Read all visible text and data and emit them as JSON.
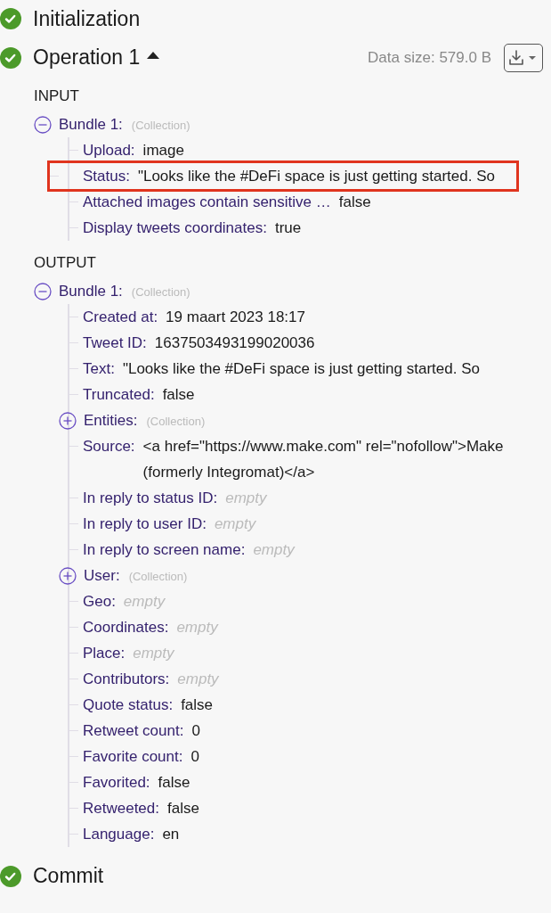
{
  "stages": [
    {
      "name": "Initialization",
      "done": true
    },
    {
      "name": "Operation 1",
      "done": true,
      "expanded": true,
      "data_size": "Data size: 579.0 B",
      "sections": [
        {
          "title": "INPUT",
          "bundles": [
            {
              "label": "Bundle 1:",
              "type": "(Collection)",
              "expanded": true,
              "items": [
                {
                  "kind": "field",
                  "label": "Upload:",
                  "value": "image",
                  "highlighted": false
                },
                {
                  "kind": "field",
                  "label": "Status:",
                  "value": "\"Looks like the #DeFi space is just getting started. So",
                  "highlighted": true
                },
                {
                  "kind": "field",
                  "label": "Attached images contain sensitive …",
                  "value": "false",
                  "highlighted": false
                },
                {
                  "kind": "field",
                  "label": "Display tweets coordinates:",
                  "value": "true",
                  "highlighted": false
                }
              ]
            }
          ]
        },
        {
          "title": "OUTPUT",
          "bundles": [
            {
              "label": "Bundle 1:",
              "type": "(Collection)",
              "expanded": true,
              "items": [
                {
                  "kind": "field",
                  "label": "Created at:",
                  "value": "19 maart 2023 18:17",
                  "highlighted": false
                },
                {
                  "kind": "field",
                  "label": "Tweet ID:",
                  "value": "1637503493199020036",
                  "highlighted": false
                },
                {
                  "kind": "field",
                  "label": "Text:",
                  "value": "\"Looks like the #DeFi space is just getting started. So",
                  "highlighted": false
                },
                {
                  "kind": "field",
                  "label": "Truncated:",
                  "value": "false",
                  "highlighted": false
                },
                {
                  "kind": "collection",
                  "label": "Entities:",
                  "value": "(Collection)",
                  "expanded": false
                },
                {
                  "kind": "field",
                  "label": "Source:",
                  "value": "<a href=\"https://www.make.com\" rel=\"nofollow\">Make (formerly Integromat)</a>",
                  "highlighted": false
                },
                {
                  "kind": "empty",
                  "label": "In reply to status ID:",
                  "value": "empty"
                },
                {
                  "kind": "empty",
                  "label": "In reply to user ID:",
                  "value": "empty"
                },
                {
                  "kind": "empty",
                  "label": "In reply to screen name:",
                  "value": "empty"
                },
                {
                  "kind": "collection",
                  "label": "User:",
                  "value": "(Collection)",
                  "expanded": false
                },
                {
                  "kind": "empty",
                  "label": "Geo:",
                  "value": "empty"
                },
                {
                  "kind": "empty",
                  "label": "Coordinates:",
                  "value": "empty"
                },
                {
                  "kind": "empty",
                  "label": "Place:",
                  "value": "empty"
                },
                {
                  "kind": "empty",
                  "label": "Contributors:",
                  "value": "empty"
                },
                {
                  "kind": "field",
                  "label": "Quote status:",
                  "value": "false",
                  "highlighted": false
                },
                {
                  "kind": "field",
                  "label": "Retweet count:",
                  "value": "0",
                  "highlighted": false
                },
                {
                  "kind": "field",
                  "label": "Favorite count:",
                  "value": "0",
                  "highlighted": false
                },
                {
                  "kind": "field",
                  "label": "Favorited:",
                  "value": "false",
                  "highlighted": false
                },
                {
                  "kind": "field",
                  "label": "Retweeted:",
                  "value": "false",
                  "highlighted": false
                },
                {
                  "kind": "field",
                  "label": "Language:",
                  "value": "en",
                  "highlighted": false
                }
              ]
            }
          ]
        }
      ]
    },
    {
      "name": "Commit",
      "done": true
    }
  ]
}
